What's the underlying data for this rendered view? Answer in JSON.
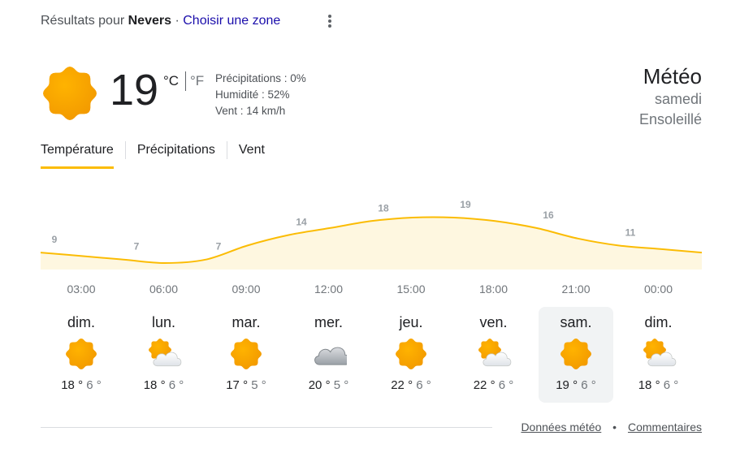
{
  "header": {
    "prefix": "Résultats pour",
    "city": "Nevers",
    "separator": "·",
    "zone_link": "Choisir une zone",
    "menu_icon": "more-vert-icon"
  },
  "current": {
    "icon": "sunny-icon",
    "temperature": "19",
    "unit_c": "°C",
    "unit_f": "°F",
    "precipitation": "Précipitations : 0%",
    "humidity": "Humidité : 52%",
    "wind": "Vent : 14 km/h"
  },
  "side": {
    "title": "Météo",
    "day": "samedi",
    "condition": "Ensoleillé"
  },
  "tabs": [
    {
      "label": "Température",
      "active": true
    },
    {
      "label": "Précipitations",
      "active": false
    },
    {
      "label": "Vent",
      "active": false
    }
  ],
  "chart_data": {
    "type": "area",
    "x": [
      "00:00",
      "03:00",
      "06:00",
      "09:00",
      "12:00",
      "15:00",
      "18:00",
      "21:00",
      "00:00"
    ],
    "labels": [
      "9",
      "7",
      "7",
      "14",
      "18",
      "19",
      "16",
      "11"
    ],
    "label_positions": [
      0,
      1,
      2,
      3,
      4,
      5,
      6,
      7
    ],
    "values": [
      9,
      8,
      7,
      6,
      7,
      11,
      14,
      16,
      18,
      19,
      19,
      18,
      16,
      13,
      11,
      10,
      9
    ],
    "fill_color": "#fef7e0",
    "line_color": "#fbbc04"
  },
  "hours": [
    "03:00",
    "06:00",
    "09:00",
    "12:00",
    "15:00",
    "18:00",
    "21:00",
    "00:00"
  ],
  "days": [
    {
      "name": "dim.",
      "icon": "sunny-icon",
      "hi": "18 °",
      "lo": "6 °",
      "selected": false
    },
    {
      "name": "lun.",
      "icon": "partly-cloudy-icon",
      "hi": "18 °",
      "lo": "6 °",
      "selected": false
    },
    {
      "name": "mar.",
      "icon": "sunny-icon",
      "hi": "17 °",
      "lo": "5 °",
      "selected": false
    },
    {
      "name": "mer.",
      "icon": "cloudy-icon",
      "hi": "20 °",
      "lo": "5 °",
      "selected": false
    },
    {
      "name": "jeu.",
      "icon": "sunny-icon",
      "hi": "22 °",
      "lo": "6 °",
      "selected": false
    },
    {
      "name": "ven.",
      "icon": "partly-cloudy-icon",
      "hi": "22 °",
      "lo": "6 °",
      "selected": false
    },
    {
      "name": "sam.",
      "icon": "sunny-icon",
      "hi": "19 °",
      "lo": "6 °",
      "selected": true
    },
    {
      "name": "dim.",
      "icon": "partly-cloudy-icon",
      "hi": "18 °",
      "lo": "6 °",
      "selected": false
    }
  ],
  "footer": {
    "data_link": "Données météo",
    "separator": "•",
    "comments_link": "Commentaires"
  }
}
